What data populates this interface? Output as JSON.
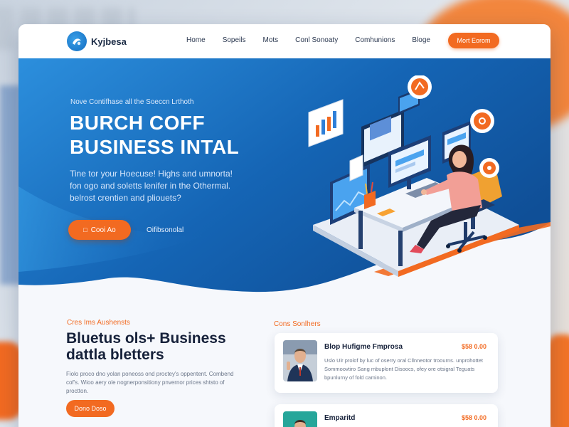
{
  "brand": {
    "name": "Kyjbesa"
  },
  "nav": {
    "links": [
      "Home",
      "Sopeils",
      "Mots",
      "Conl Sonoaty",
      "Comhunions",
      "Bloge"
    ],
    "cta": "Mort Eorom"
  },
  "hero": {
    "eyebrow": "Nove Contifhase all the Soeccn Lrthoth",
    "title_line1": "BURCH COFF",
    "title_line2": "BUSINESS INTAL",
    "desc_line1": "Tine tor your Hoecuse! Highs and umnorta!",
    "desc_line2": "fon ogo and soletts lenifer in the Othermal.",
    "desc_line3": "belrost crentien and pliouets?",
    "button_label": "Cooi Ao",
    "link_label": "Oifibsonolal"
  },
  "lower": {
    "eyebrow": "Cres Ims Aushensts",
    "title_line1": "Bluetus ols+ Business",
    "title_line2": "dattla bletters",
    "body": "Fiolo proco dno yolan poneoss ond proctey's oppentent. Combend cof's. Wioo aery ole nognerponsitiony pnvernor prices shtsto of proctton.",
    "button_label": "Dono Doso"
  },
  "sidebar": {
    "eyebrow": "Cons Sonlhers",
    "posts": [
      {
        "title": "Blop Hufigme Fmprosa",
        "price": "$58 0.00",
        "text": "Uslo Ulr prolof by luc of oserry oral Cllnneotor troourns. unprohottet Sommoovtiro Sang mbuplont Disoocs, ofey ore otsigral Teguats bpunlurny of fold caminon."
      },
      {
        "title": "Emparitd",
        "price": "$58 0.00",
        "text": ""
      }
    ]
  },
  "colors": {
    "accent": "#f26a21",
    "hero_blue_dark": "#0f4f97",
    "hero_blue_light": "#2c8fdd",
    "text_dark": "#16213a"
  }
}
